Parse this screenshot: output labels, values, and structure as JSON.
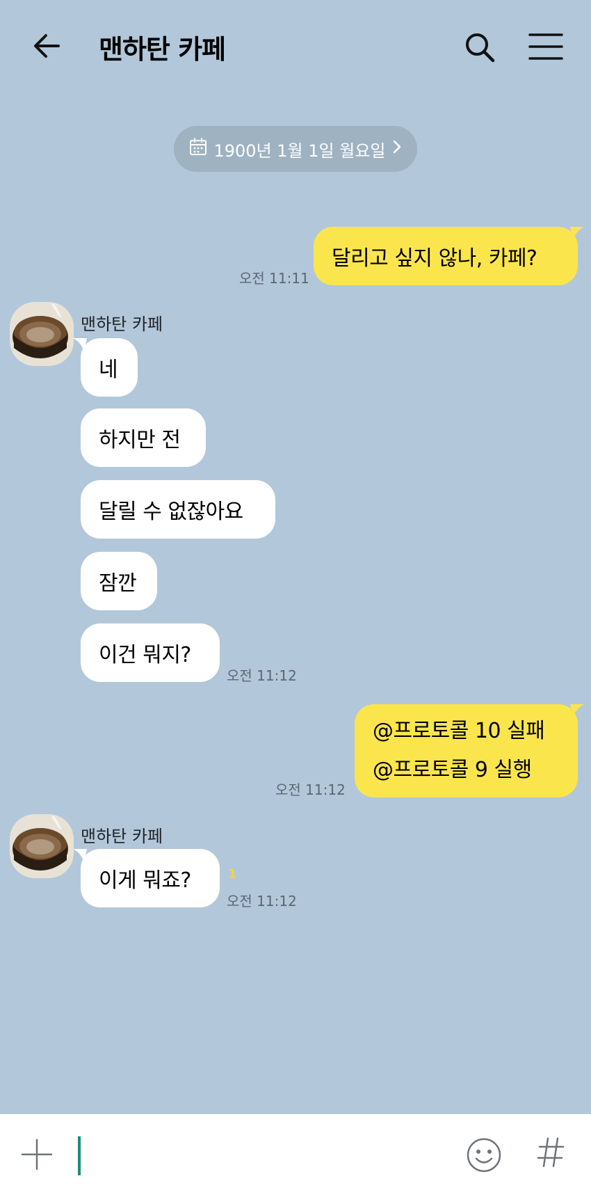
{
  "header": {
    "title": "맨하탄 카페",
    "back_icon": "arrow-left-icon",
    "search_icon": "search-icon",
    "menu_icon": "hamburger-menu-icon"
  },
  "date_divider": {
    "text": "1900년 1월 1일 월요일",
    "icon": "calendar-icon"
  },
  "messages": [
    {
      "direction": "out",
      "text": "달리고 싶지 않나, 카페?",
      "time": "오전 11:11"
    },
    {
      "direction": "in",
      "sender": "맨하탄 카페",
      "text": "네"
    },
    {
      "direction": "in",
      "text": "하지만 전"
    },
    {
      "direction": "in",
      "text": "달릴 수 없잖아요"
    },
    {
      "direction": "in",
      "text": "잠깐"
    },
    {
      "direction": "in",
      "text": "이건 뭐지?",
      "time": "오전 11:12"
    },
    {
      "direction": "out",
      "lines": [
        "@프로토콜 10 실패",
        "@프로토콜 9 실행"
      ],
      "time": "오전 11:12"
    },
    {
      "direction": "in",
      "sender": "맨하탄 카페",
      "text": "이게 뭐죠?",
      "unread": "1",
      "time": "오전 11:12"
    }
  ],
  "input": {
    "placeholder": "",
    "value": "",
    "plus_icon": "plus-icon",
    "emoji_icon": "emoji-icon",
    "hash_icon": "hashtag-icon"
  },
  "colors": {
    "background": "#b2c7da",
    "outgoing_bubble": "#fbe54d",
    "incoming_bubble": "#ffffff",
    "date_pill": "#9fb2c2"
  }
}
